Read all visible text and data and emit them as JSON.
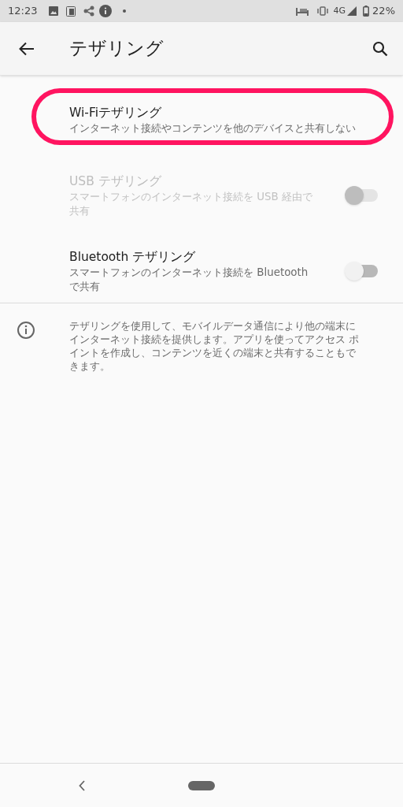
{
  "status_bar": {
    "time": "12:23",
    "network": "4G",
    "battery": "22%"
  },
  "app_bar": {
    "title": "テザリング"
  },
  "items": [
    {
      "kind": "plain",
      "title": "Wi-Fiテザリング",
      "summary": "インターネット接続やコンテンツを他のデバイスと共有しない",
      "disabled": false,
      "highlighted": true
    },
    {
      "kind": "switch",
      "title": "USB テザリング",
      "summary": "スマートフォンのインターネット接続を USB 経由で共有",
      "disabled": true,
      "on": false,
      "highlighted": false
    },
    {
      "kind": "switch",
      "title": "Bluetooth テザリング",
      "summary": "スマートフォンのインターネット接続を Bluetooth で共有",
      "disabled": false,
      "on": false,
      "highlighted": false
    }
  ],
  "info": "テザリングを使用して、モバイルデータ通信により他の端末にインターネット接続を提供します。アプリを使ってアクセス ポイントを作成し、コンテンツを近くの端末と共有することもできます。"
}
